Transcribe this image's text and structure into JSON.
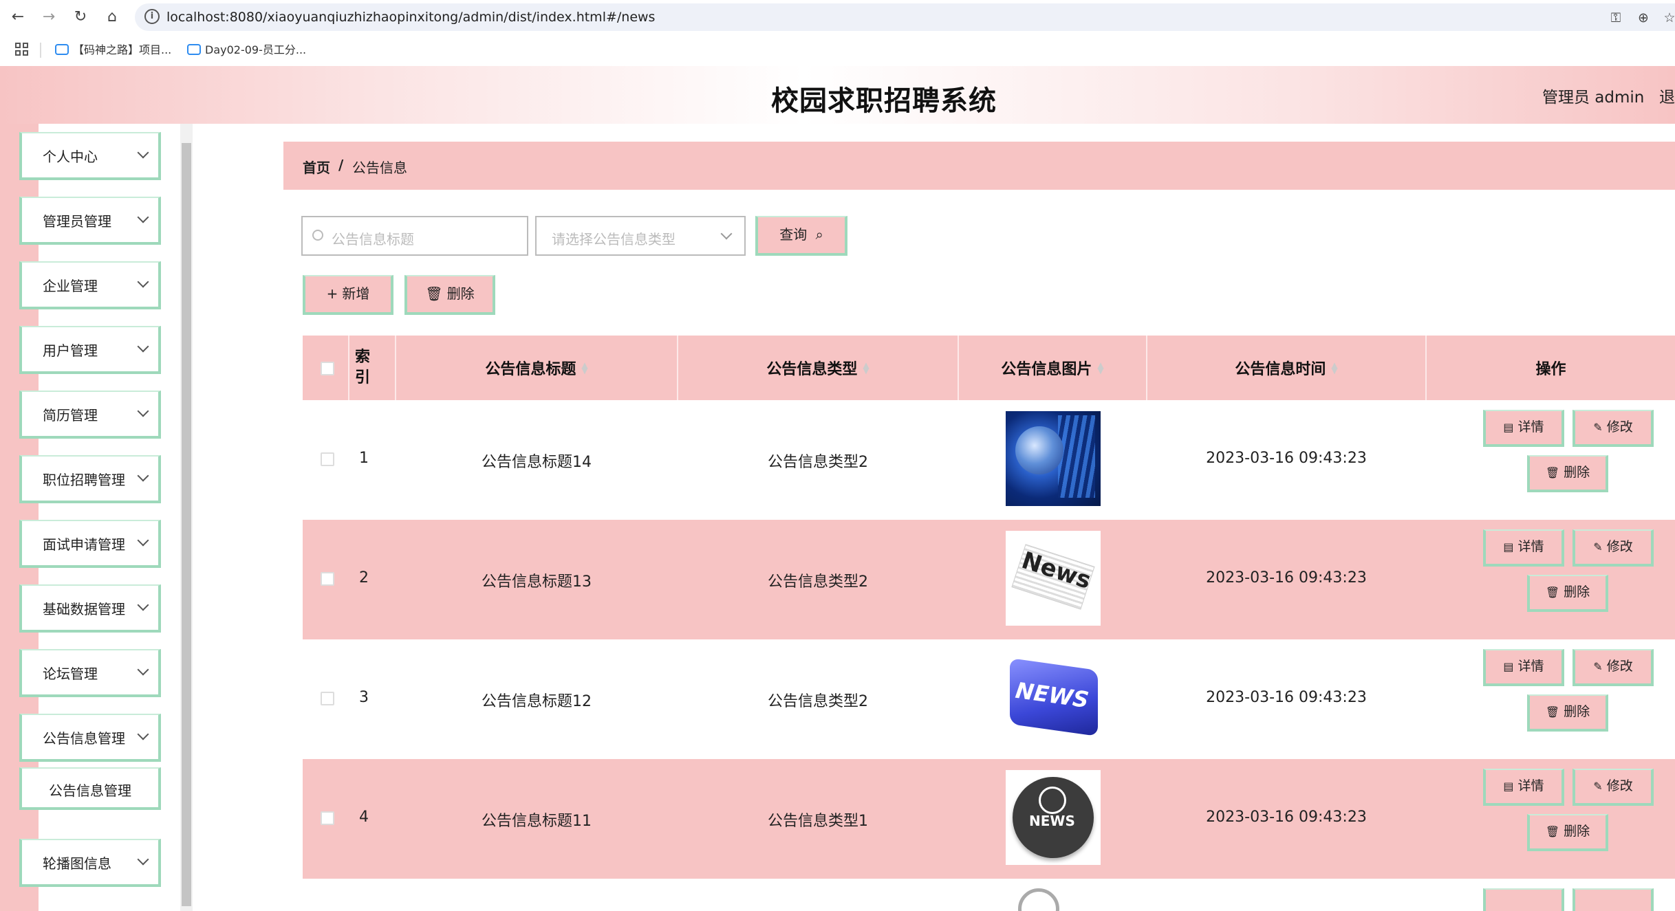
{
  "browser": {
    "url": "localhost:8080/xiaoyuanqiuzhizhaopinxitong/admin/dist/index.html#/news",
    "bookmarks": [
      "【码神之路】项目...",
      "Day02-09-员工分..."
    ]
  },
  "header": {
    "title": "校园求职招聘系统",
    "user": "管理员 admin",
    "logout": "退出"
  },
  "sidebar": {
    "items": [
      {
        "label": "个人中心"
      },
      {
        "label": "管理员管理"
      },
      {
        "label": "企业管理"
      },
      {
        "label": "用户管理"
      },
      {
        "label": "简历管理"
      },
      {
        "label": "职位招聘管理"
      },
      {
        "label": "面试申请管理"
      },
      {
        "label": "基础数据管理"
      },
      {
        "label": "论坛管理"
      },
      {
        "label": "公告信息管理"
      }
    ],
    "submenu_label": "公告信息管理",
    "last_item": "轮播图信息"
  },
  "breadcrumb": {
    "home": "首页",
    "sep": "/",
    "current": "公告信息"
  },
  "search": {
    "title_placeholder": "公告信息标题",
    "type_placeholder": "请选择公告信息类型",
    "query_label": "查询"
  },
  "actions": {
    "add_label": "新增",
    "delete_label": "删除"
  },
  "table": {
    "headers": {
      "index": "索\n引",
      "title": "公告信息标题",
      "type": "公告信息类型",
      "image": "公告信息图片",
      "time": "公告信息时间",
      "ops": "操作"
    },
    "row_buttons": {
      "detail": "详情",
      "edit": "修改",
      "delete": "删除"
    },
    "rows": [
      {
        "index": "1",
        "title": "公告信息标题14",
        "type": "公告信息类型2",
        "time": "2023-03-16 09:43:23",
        "image": "globe-image"
      },
      {
        "index": "2",
        "title": "公告信息标题13",
        "type": "公告信息类型2",
        "time": "2023-03-16 09:43:23",
        "image": "news-paper-image"
      },
      {
        "index": "3",
        "title": "公告信息标题12",
        "type": "公告信息类型2",
        "time": "2023-03-16 09:43:23",
        "image": "news-key-image"
      },
      {
        "index": "4",
        "title": "公告信息标题11",
        "type": "公告信息类型1",
        "time": "2023-03-16 09:43:23",
        "image": "news-globe-icon-image"
      }
    ]
  },
  "colors": {
    "pink": "#f7c4c4",
    "green_border": "#9ed9bb"
  }
}
